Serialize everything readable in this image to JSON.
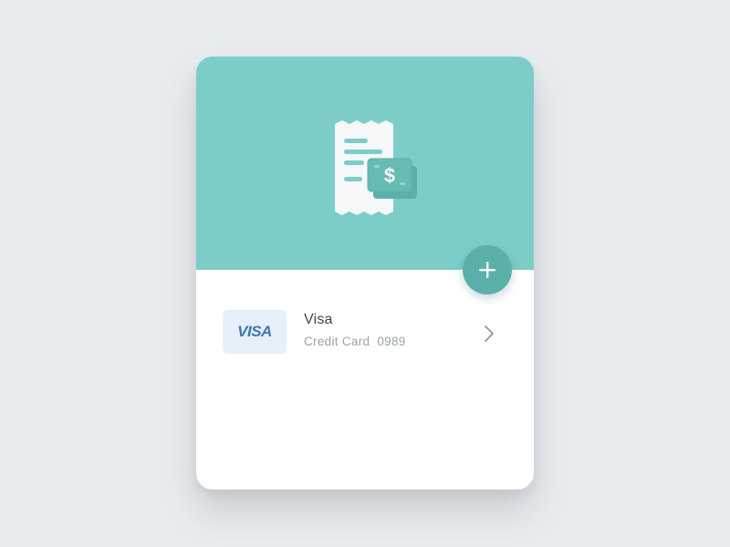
{
  "colors": {
    "background": "#e9ecef",
    "header": "#7ccdc8",
    "accent": "#5bb1a9",
    "receipt": "#f5f7f8",
    "money": "#5bb1a9",
    "visa_blue": "#3f74b8",
    "visa_bg": "#e6f0fb"
  },
  "header": {
    "illustration_icon": "receipt-with-money-icon"
  },
  "add_button": {
    "icon": "plus-icon"
  },
  "payment_method": {
    "brand_logo": "VISA",
    "name": "Visa",
    "type": "Credit Card",
    "last_four": "0989",
    "action_icon": "chevron-right-icon"
  }
}
